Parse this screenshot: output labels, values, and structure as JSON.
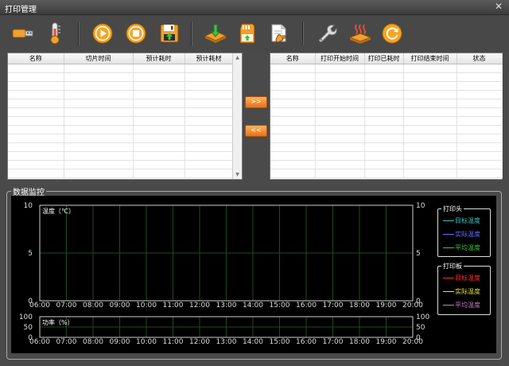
{
  "window": {
    "title": "打印管理",
    "close_glyph": "✕"
  },
  "toolbar": {
    "buttons": [
      {
        "name": "usb-icon",
        "color": "#f0a030"
      },
      {
        "name": "thermometer-icon",
        "color": "#f0a030"
      },
      {
        "name": "play-icon",
        "color": "#f5a623"
      },
      {
        "name": "stop-icon",
        "color": "#f5a623"
      },
      {
        "name": "save-disk-icon",
        "color": "#f0a030"
      },
      {
        "name": "download-layer-icon",
        "color": "#f0a030"
      },
      {
        "name": "sd-card-icon",
        "color": "#f0a030"
      },
      {
        "name": "document-hand-icon",
        "color": "#f0a030"
      },
      {
        "name": "wrench-icon",
        "color": "#f0a030"
      },
      {
        "name": "heated-bed-icon",
        "color": "#f0a030"
      },
      {
        "name": "refresh-icon",
        "color": "#f5a623"
      }
    ]
  },
  "left_table": {
    "columns": [
      "名称",
      "切片时间",
      "预计耗时",
      "预计耗材"
    ]
  },
  "right_table": {
    "columns": [
      "名称",
      "打印开始时间",
      "打印已耗时",
      "打印结束时间",
      "状态"
    ]
  },
  "transfer": {
    "forward_label": ">>",
    "back_label": "<<"
  },
  "monitor": {
    "label": "数据监控"
  },
  "chart_data": [
    {
      "type": "line",
      "ylabel": "温度（℃）",
      "ylim": [
        0,
        10
      ],
      "yticks": [
        "0",
        "5",
        "10"
      ],
      "x": [
        "06:00",
        "07:00",
        "08:00",
        "09:00",
        "10:00",
        "11:00",
        "12:00",
        "13:00",
        "14:00",
        "15:00",
        "16:00",
        "17:00",
        "18:00",
        "19:00",
        "20:00"
      ],
      "grid": true,
      "series": []
    },
    {
      "type": "line",
      "ylabel": "功率（%）",
      "ylim": [
        0,
        100
      ],
      "yticks": [
        "0",
        "50",
        "100"
      ],
      "x": [
        "06:00",
        "07:00",
        "08:00",
        "09:00",
        "10:00",
        "11:00",
        "12:00",
        "13:00",
        "14:00",
        "15:00",
        "16:00",
        "17:00",
        "18:00",
        "19:00",
        "20:00"
      ],
      "grid": true,
      "series": []
    }
  ],
  "legends": {
    "head": {
      "title": "打印头",
      "items": [
        {
          "label": "目标温度",
          "color": "#40c0c0"
        },
        {
          "label": "实际温度",
          "color": "#6a6aff"
        },
        {
          "label": "平均温度",
          "color": "#40c040"
        }
      ]
    },
    "bed": {
      "title": "打印板",
      "items": [
        {
          "label": "目标温度",
          "color": "#ff3030"
        },
        {
          "label": "实际温度",
          "color": "#e0e040"
        },
        {
          "label": "平均温度",
          "color": "#c080c0"
        }
      ]
    }
  }
}
